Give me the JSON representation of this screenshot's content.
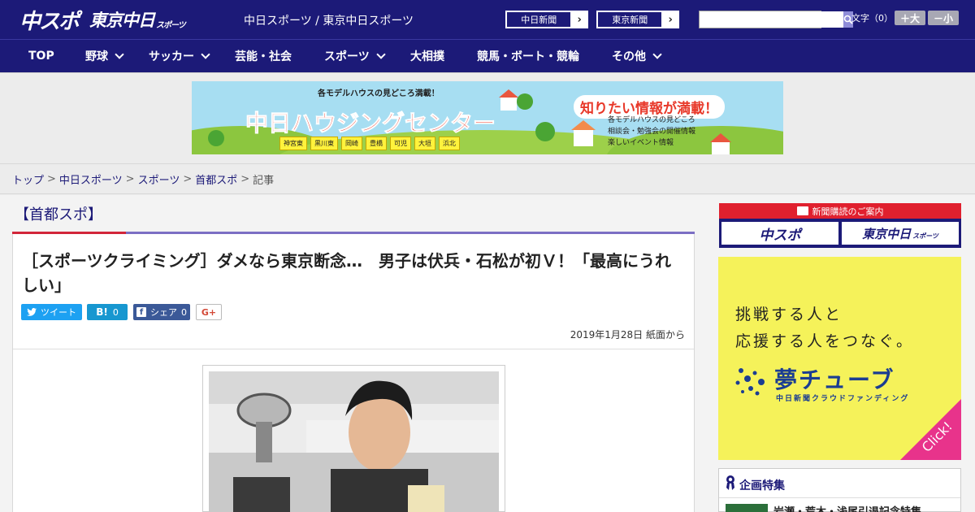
{
  "header": {
    "logo_chuspo": "中スポ",
    "logo_tokyo": "東京中日",
    "logo_tokyo_small": "スポーツ",
    "site_title": "中日スポーツ / 東京中日スポーツ",
    "link_chunichi": "中日新聞",
    "link_tokyo": "東京新聞",
    "search_placeholder": "",
    "text_size_label": "文字（0）",
    "size_plus": "＋大",
    "size_minus": "－小"
  },
  "nav": {
    "items": [
      {
        "label": "TOP",
        "has_menu": false
      },
      {
        "label": "野球",
        "has_menu": true
      },
      {
        "label": "サッカー",
        "has_menu": true
      },
      {
        "label": "芸能・社会",
        "has_menu": false
      },
      {
        "label": "スポーツ",
        "has_menu": true
      },
      {
        "label": "大相撲",
        "has_menu": false
      },
      {
        "label": "競馬・ボート・競輪",
        "has_menu": false
      },
      {
        "label": "その他",
        "has_menu": true
      }
    ]
  },
  "banner": {
    "top_text": "各モデルハウスの見どころ満載！",
    "title": "中日ハウジングセンター",
    "callout": "知りたい情報が満載！",
    "places": [
      "神宮東",
      "黒川東",
      "岡崎",
      "豊橋",
      "可児",
      "大垣",
      "浜北"
    ],
    "bullets": [
      "各モデルハウスの見どころ",
      "相談会・勉強会の開催情報",
      "楽しいイベント情報"
    ]
  },
  "breadcrumb": {
    "items": [
      "トップ",
      "中日スポーツ",
      "スポーツ",
      "首都スポ"
    ],
    "current": "記事"
  },
  "article": {
    "section": "【首都スポ】",
    "headline": "［スポーツクライミング］ダメなら東京断念…　男子は伏兵・石松が初Ｖ！「最高にうれしい」",
    "share": {
      "tweet": "ツイート",
      "hatena_icon": "B!",
      "hatena_count": "0",
      "facebook": "シェア",
      "facebook_count": "0",
      "gplus": "G+"
    },
    "date": "2019年1月28日 紙面から"
  },
  "sidebar": {
    "subscribe_head": "新聞購読のご案内",
    "sub_logo_1": "中スポ",
    "sub_logo_2": "東京中日",
    "sub_logo_2_small": "スポーツ",
    "ad_line_1": "挑戦する人と",
    "ad_line_2": "応援する人をつなぐ。",
    "ad_brand": "夢チューブ",
    "ad_brand_sub": "中日新聞クラウドファンディング",
    "ad_click": "Click!",
    "feature_title": "企画特集",
    "feature_item_text": "岩瀬・荒木・浅尾引退記念特集"
  },
  "colors": {
    "brand_navy": "#1c1a78",
    "accent_red": "#d2263a",
    "accent_purple": "#7c6fc4",
    "ad_yellow": "#f5f25a",
    "ad_pink": "#e8338b"
  }
}
